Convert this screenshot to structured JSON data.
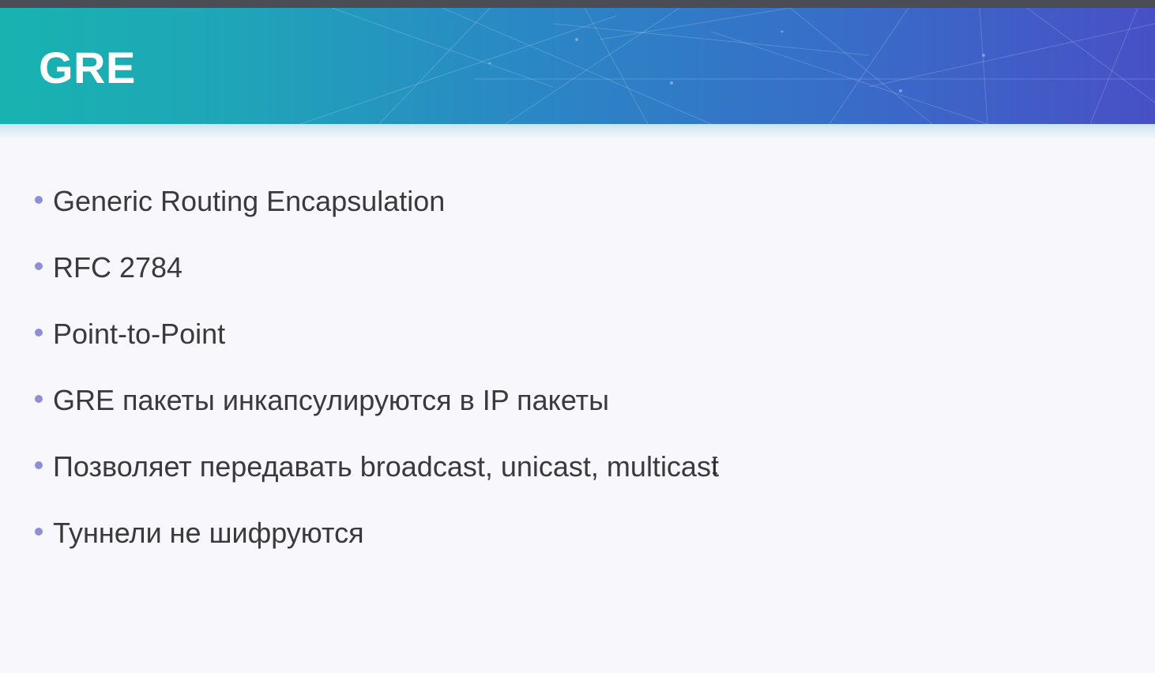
{
  "slide": {
    "title": "GRE",
    "bullets": [
      "Generic Routing Encapsulation",
      "RFC 2784",
      "Point-to-Point",
      "GRE пакеты инкапсулируются в IP пакеты",
      "Позволяет передавать broadcast, unicast, multicast",
      "Туннели не шифруются"
    ]
  },
  "colors": {
    "header_gradient_start": "#18b3b0",
    "header_gradient_end": "#4850c6",
    "bullet_dot": "#8f8fd8",
    "text": "#3a3a3c",
    "background": "#f8f7fc"
  },
  "icons": {
    "cursor": "text-cursor-icon"
  }
}
